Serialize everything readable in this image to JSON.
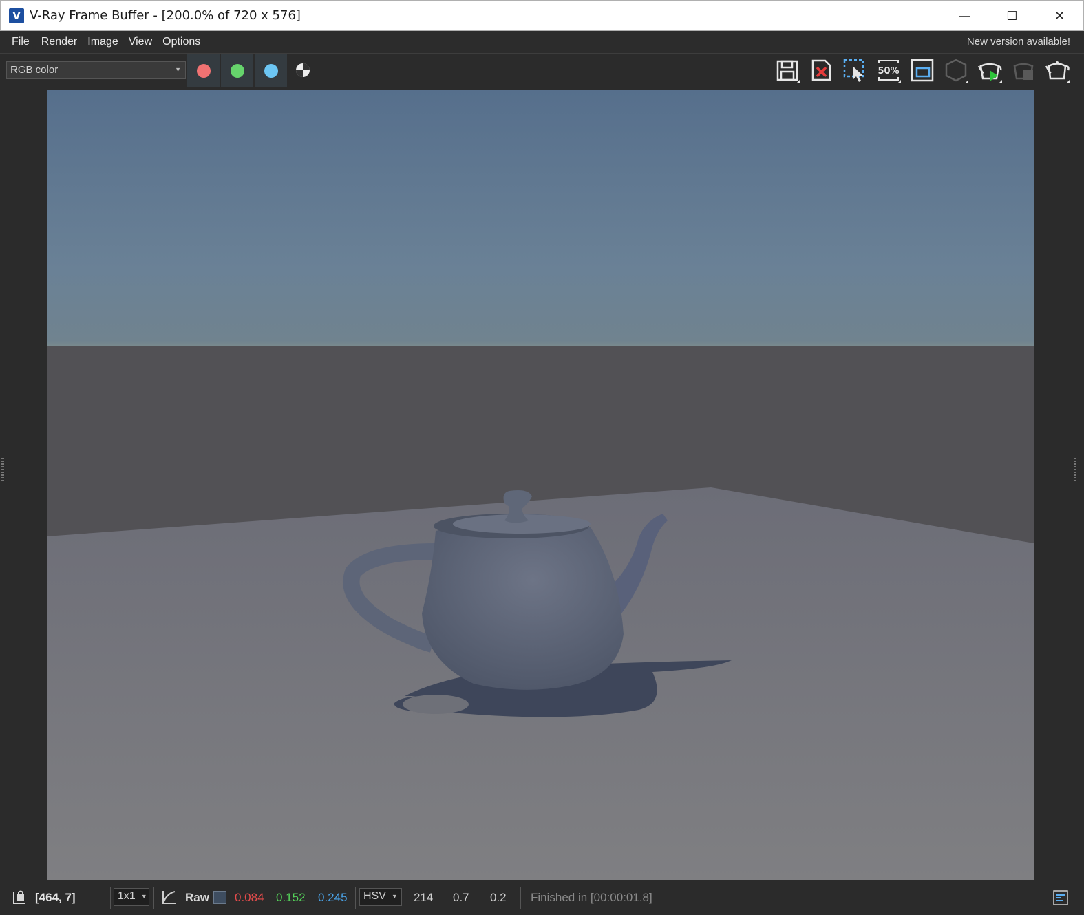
{
  "window": {
    "title": "V-Ray Frame Buffer - [200.0% of 720 x 576]",
    "logo_letter": "V",
    "minimize": "—",
    "maximize": "☐",
    "close": "✕"
  },
  "menu": {
    "items": [
      "File",
      "Render",
      "Image",
      "View",
      "Options"
    ],
    "notice": "New version available!"
  },
  "toolbar": {
    "channel": "RGB color",
    "channel_buttons": [
      {
        "name": "red",
        "color": "#f07272"
      },
      {
        "name": "green",
        "color": "#66d46c"
      },
      {
        "name": "blue",
        "color": "#6cc6f4"
      }
    ],
    "zoom_label": "50%",
    "icons": [
      "save-icon",
      "clear-image-icon",
      "region-select-icon",
      "zoom-50-icon",
      "show-history-icon",
      "track-mouse-icon",
      "start-interactive-render-icon",
      "stop-render-icon",
      "render-icon"
    ]
  },
  "status": {
    "coords": "[464, 7]",
    "sample_size": "1x1",
    "raw_label": "Raw",
    "swatch_color": "#3e4d60",
    "r": "0.084",
    "g": "0.152",
    "b": "0.245",
    "color_mode": "HSV",
    "h": "214",
    "s": "0.7",
    "v": "0.2",
    "message": "Finished in [00:00:01.8]",
    "colors": {
      "r": "#e84c4c",
      "g": "#55d45a",
      "b": "#4aa3e8"
    }
  }
}
